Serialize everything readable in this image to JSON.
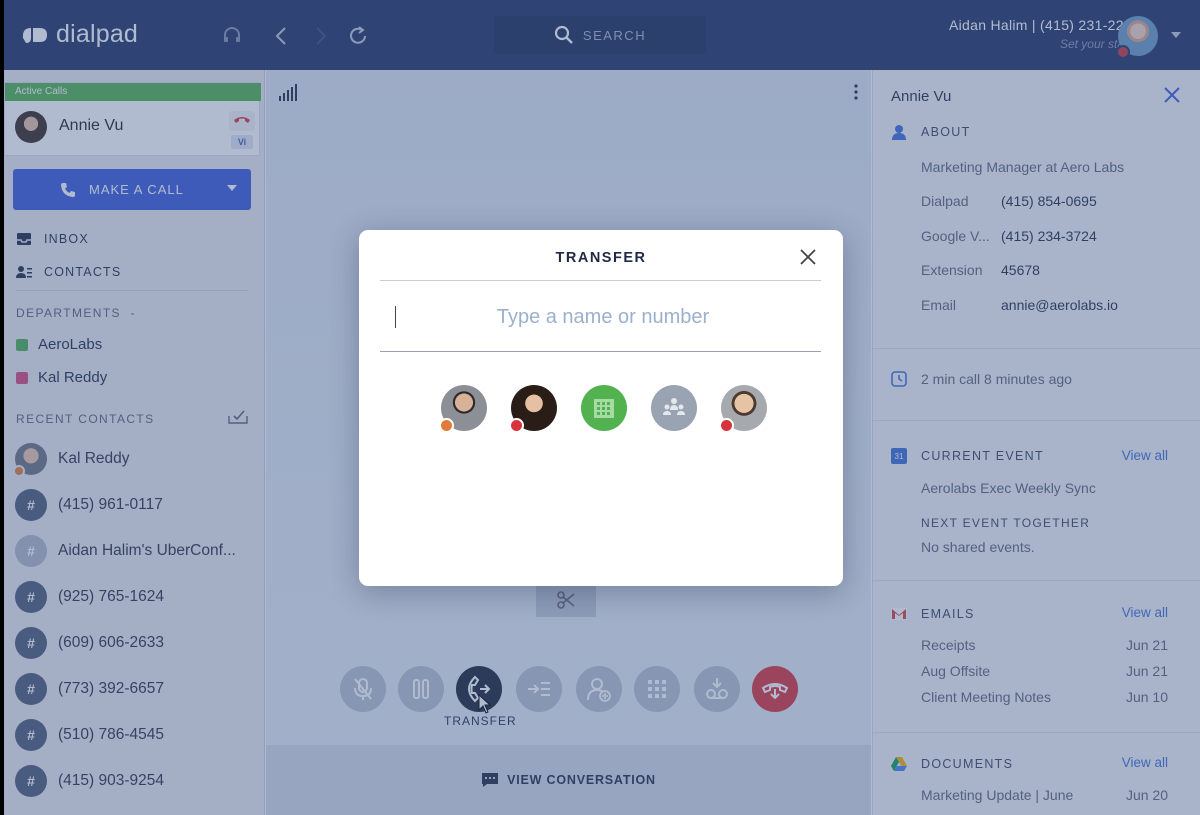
{
  "app": {
    "brand": "dialpad"
  },
  "topbar": {
    "search_label": "SEARCH",
    "user_name": "Aidan Halim | (415) 231-2261",
    "user_status_placeholder": "Set your status"
  },
  "sidebar": {
    "active_calls_label": "Active Calls",
    "active_call_name": "Annie Vu",
    "active_call_badge": "Vi",
    "make_call_label": "MAKE A CALL",
    "nav": [
      {
        "label": "INBOX"
      },
      {
        "label": "CONTACTS"
      }
    ],
    "departments_label": "DEPARTMENTS",
    "departments_toggle": "-",
    "departments": [
      {
        "label": "AeroLabs",
        "color": "#4caf50"
      },
      {
        "label": "Kal Reddy",
        "color": "#d6487a"
      }
    ],
    "recent_label": "RECENT CONTACTS",
    "recent": [
      {
        "label": "Kal Reddy",
        "kind": "photo"
      },
      {
        "label": "(415) 961-0117",
        "kind": "hash"
      },
      {
        "label": "Aidan Halim's UberConf...",
        "kind": "hash-light"
      },
      {
        "label": "(925) 765-1624",
        "kind": "hash"
      },
      {
        "label": "(609) 606-2633",
        "kind": "hash"
      },
      {
        "label": "(773) 392-6657",
        "kind": "hash"
      },
      {
        "label": "(510) 786-4545",
        "kind": "hash"
      },
      {
        "label": "(415) 903-9254",
        "kind": "hash"
      }
    ],
    "hash_glyph": "#"
  },
  "center": {
    "transfer_label": "TRANSFER",
    "view_conversation_label": "VIEW CONVERSATION"
  },
  "modal": {
    "title": "TRANSFER",
    "input_placeholder": "Type a name or number",
    "input_value": ""
  },
  "right": {
    "name": "Annie Vu",
    "about_label": "ABOUT",
    "title": "Marketing Manager at Aero Labs",
    "fields": [
      {
        "label": "Dialpad",
        "value": "(415) 854-0695"
      },
      {
        "label": "Google V...",
        "value": "(415) 234-3724"
      },
      {
        "label": "Extension",
        "value": "45678"
      },
      {
        "label": "Email",
        "value": "annie@aerolabs.io"
      }
    ],
    "last_call": "2 min call 8 minutes ago",
    "current_event_label": "CURRENT EVENT",
    "calendar_day": "31",
    "current_event": "Aerolabs Exec Weekly Sync",
    "next_event_label": "NEXT EVENT TOGETHER",
    "next_event": "No shared events.",
    "emails_label": "EMAILS",
    "emails": [
      {
        "subject": "Receipts",
        "date": "Jun 21"
      },
      {
        "subject": "Aug Offsite",
        "date": "Jun 21"
      },
      {
        "subject": "Client Meeting Notes",
        "date": "Jun 10"
      }
    ],
    "documents_label": "DOCUMENTS",
    "documents": [
      {
        "name": "Marketing Update | June",
        "date": "Jun 20"
      }
    ],
    "view_all_label": "View all"
  },
  "colors": {
    "topbar": "#1f3264",
    "accent": "#3b5bdb",
    "end_call": "#d8333c",
    "active_calls": "#52b24f"
  }
}
